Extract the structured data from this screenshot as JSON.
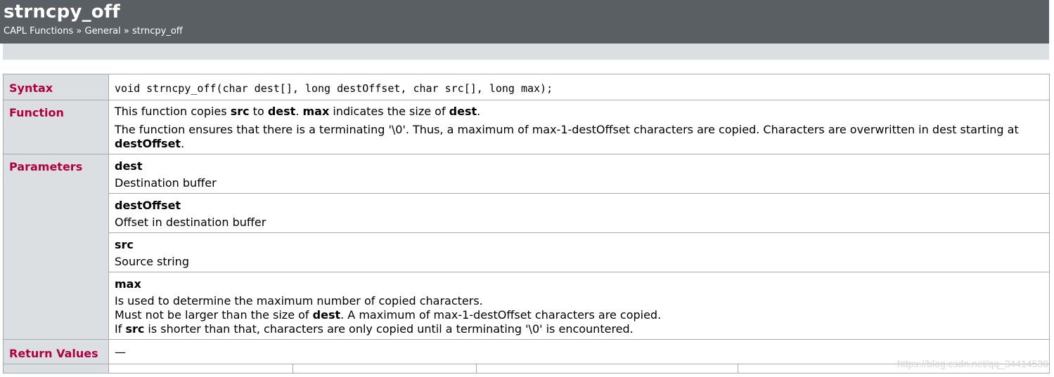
{
  "header": {
    "title": "strncpy_off",
    "breadcrumb": [
      "CAPL Functions",
      "General",
      "strncpy_off"
    ],
    "separator": "»"
  },
  "rows": {
    "syntax": {
      "label": "Syntax",
      "code": "void strncpy_off(char dest[], long destOffset, char src[], long max);"
    },
    "function": {
      "label": "Function",
      "line1": {
        "t1": "This function copies ",
        "b1": "src",
        "t2": " to ",
        "b2": "dest",
        "t3": ". ",
        "b3": "max",
        "t4": " indicates the size of ",
        "b4": "dest",
        "t5": "."
      },
      "line2": {
        "t1": "The function ensures that there is a terminating '\\0'. Thus, a maximum of max-1-destOffset characters are copied. Characters are overwritten in dest starting at ",
        "b1": "destOffset",
        "t2": "."
      }
    },
    "parameters": {
      "label": "Parameters",
      "items": [
        {
          "name": "dest",
          "desc": "Destination buffer"
        },
        {
          "name": "destOffset",
          "desc": "Offset in destination buffer"
        },
        {
          "name": "src",
          "desc": "Source string"
        },
        {
          "name": "max",
          "desc1": "Is used to determine the maximum number of copied characters.",
          "desc2a": "Must not be larger than the size of ",
          "desc2b": "dest",
          "desc2c": ". A maximum of max-1-destOffset characters are copied.",
          "desc3a": "If ",
          "desc3b": "src",
          "desc3c": " is shorter than that, characters are only copied until a terminating '\\0' is encountered."
        }
      ]
    },
    "return_values": {
      "label": "Return Values",
      "value": "—"
    }
  },
  "watermark": "https://blog.csdn.net/qq_34414530"
}
